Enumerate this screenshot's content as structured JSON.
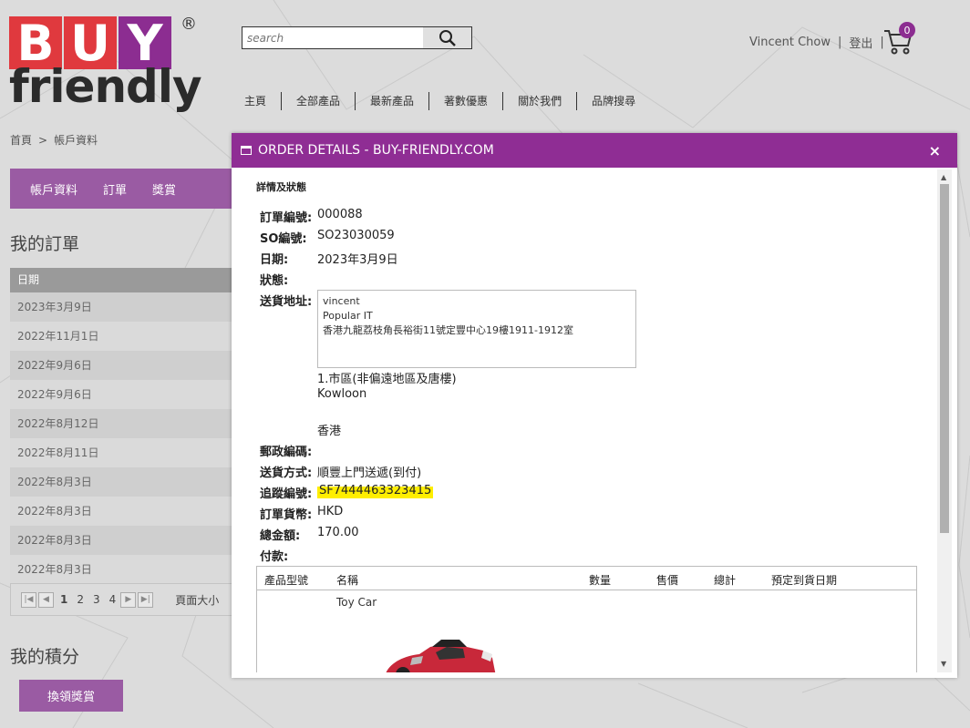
{
  "site": {
    "logo_top": "BUY",
    "logo_bottom": "friendly",
    "logo_mark": "®",
    "search_placeholder": "search",
    "user_name": "Vincent Chow",
    "logout": "登出",
    "cart_count": "0",
    "nav": [
      "主頁",
      "全部產品",
      "最新產品",
      "著數優惠",
      "關於我們",
      "品牌搜尋"
    ]
  },
  "breadcrumb": {
    "home": "首頁",
    "separator": ">",
    "current": "帳戶資料"
  },
  "account_tabs": [
    "帳戶資料",
    "訂單",
    "獎賞"
  ],
  "orders": {
    "heading": "我的訂單",
    "column": "日期",
    "dates": [
      "2023年3月9日",
      "2022年11月1日",
      "2022年9月6日",
      "2022年9月6日",
      "2022年8月12日",
      "2022年8月11日",
      "2022年8月3日",
      "2022年8月3日",
      "2022年8月3日",
      "2022年8月3日"
    ],
    "pager": {
      "first": "|◀",
      "prev": "◀",
      "pages": [
        "1",
        "2",
        "3",
        "4"
      ],
      "next": "▶",
      "last": "▶|",
      "page_size": "頁面大小"
    }
  },
  "points": {
    "heading": "我的積分",
    "redeem_button": "換領獎賞"
  },
  "modal": {
    "title": "ORDER DETAILS - BUY-FRIENDLY.COM",
    "close": "×",
    "section_title": "詳情及狀態",
    "order_no_label": "訂單編號:",
    "order_no": "000088",
    "so_label": "SO編號:",
    "so_no": "SO23030059",
    "date_label": "日期:",
    "date": "2023年3月9日",
    "status_label": "狀態:",
    "status": "",
    "address_label": "送貨地址:",
    "address_lines": [
      "vincent",
      "Popular IT",
      "香港九龍荔枝角長裕街11號定豐中心19樓1911-1912室"
    ],
    "district": "1.市區(非偏遠地區及唐樓)",
    "city": "Kowloon",
    "country": "香港",
    "postal_label": "郵政編碼:",
    "postal": "",
    "shipping_label": "送貨方式:",
    "shipping": "順豐上門送遞(到付)",
    "tracking_label": "追蹤編號:",
    "tracking": "SF7444463323415",
    "currency_label": "訂單貨幣:",
    "currency": "HKD",
    "total_label": "總金額:",
    "total": "170.00",
    "payment_label": "付款:",
    "payment": "",
    "items_columns": [
      "產品型號",
      "名稱",
      "數量",
      "售價",
      "總計",
      "預定到貨日期"
    ],
    "item_name": "Toy Car"
  },
  "colors": {
    "brand_purple": "#8f2d94",
    "tab_purple": "#9a5ba3",
    "logo_red": "#e0393e",
    "highlight": "#ffee00"
  }
}
